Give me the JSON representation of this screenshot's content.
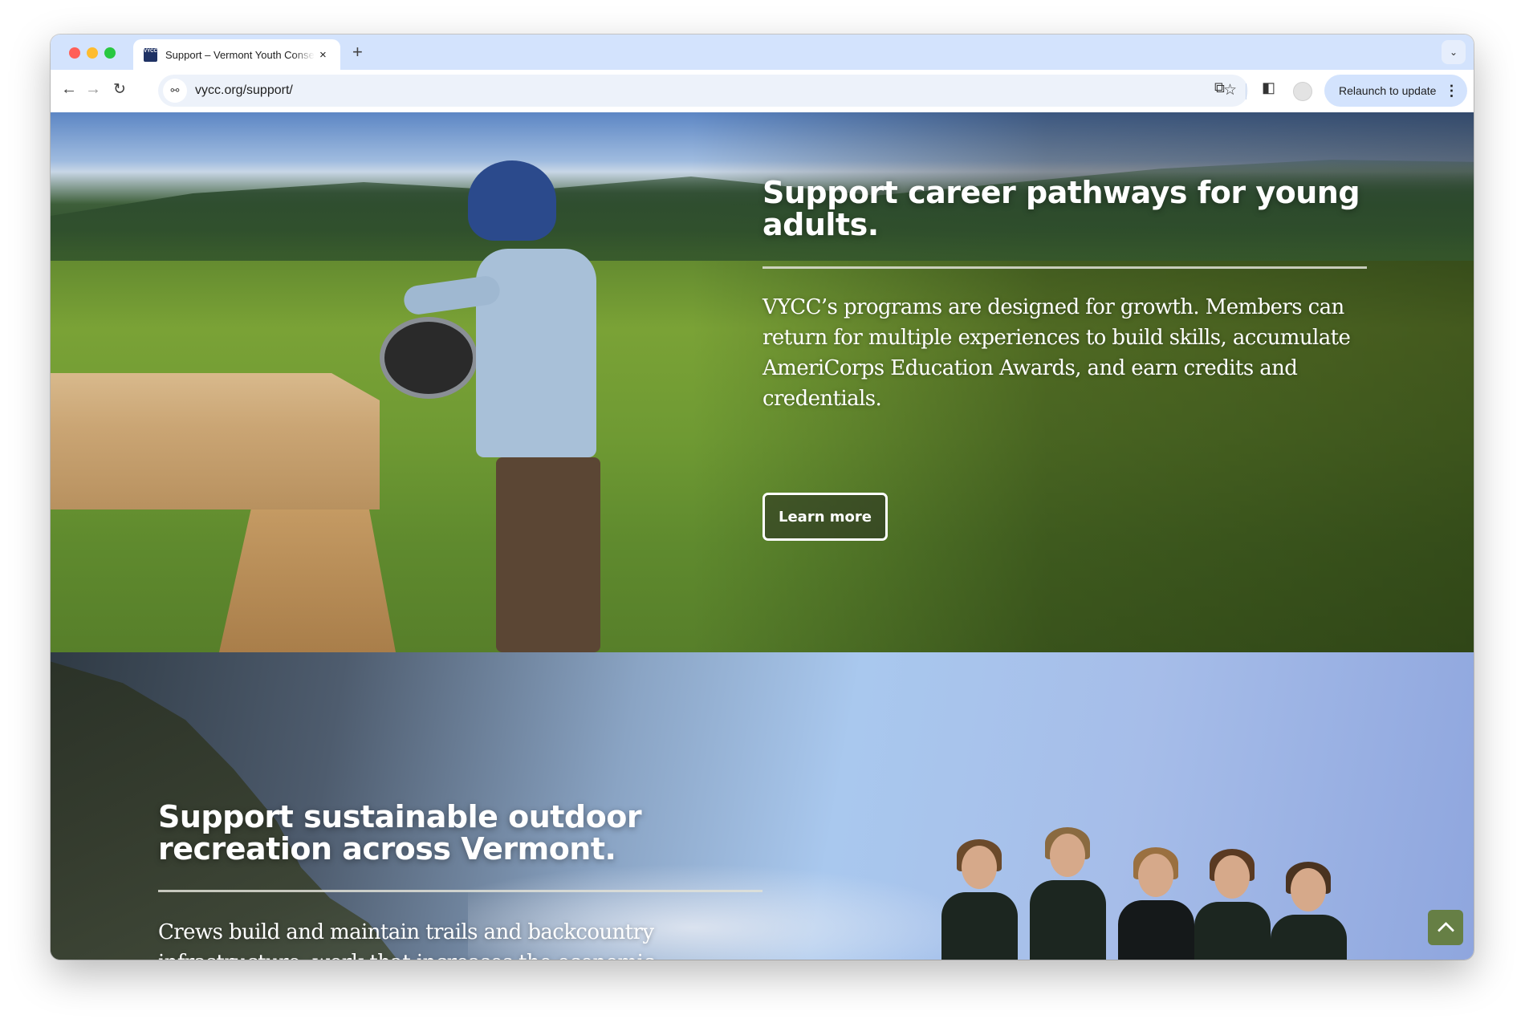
{
  "browser": {
    "tab": {
      "title": "Support – Vermont Youth Conservation Corps",
      "favicon_label": "VYCC",
      "close_icon": "×"
    },
    "new_tab_icon": "+",
    "tab_search_icon": "⌄",
    "nav": {
      "back_icon": "←",
      "forward_icon": "→",
      "reload_icon": "↻"
    },
    "address_bar": {
      "site_info_icon": "⚯",
      "url": "vycc.org/support/",
      "bookmark_icon": "☆"
    },
    "extensions_icon": "⧉",
    "side_panel_icon": "◧",
    "relaunch": {
      "label": "Relaunch to update",
      "menu_icon": "⋮"
    }
  },
  "sections": [
    {
      "heading": "Support career pathways for young adults.",
      "body": "VYCC’s programs are designed for growth. Members can return for multiple experiences to build skills, accumulate AmeriCorps Education Awards, and earn credits and credentials.",
      "button_label": "Learn more"
    },
    {
      "heading": "Support sustainable outdoor recreation across Vermont.",
      "body": "Crews build and maintain trails and backcountry infrastructure, work that increases the economic"
    }
  ],
  "scroll_to_top": {
    "color": "#667f45"
  },
  "colors": {
    "tab_strip": "#d3e3fd",
    "omnibox": "#edf2fa",
    "relaunch_button": "#d3e3fd"
  }
}
